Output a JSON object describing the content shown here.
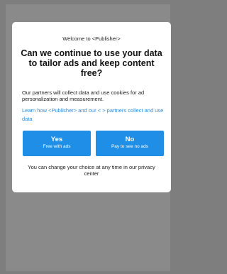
{
  "consent_dialog": {
    "welcome": "Welcome to <Publisher>",
    "headline": "Can we continue to use your data to tailor ads and keep content free?",
    "body": "Our partners will collect data and use cookies for ad personalization and measurement.",
    "learn_link": "Learn how <Publisher> and our <    > partners collect and use data",
    "yes_button": {
      "label": "Yes",
      "sublabel": "Free with ads"
    },
    "no_button": {
      "label": "No",
      "sublabel": "Pay to see no ads"
    },
    "footer_note": "You can change your choice at any time in our privacy center"
  },
  "colors": {
    "backdrop": "#7e7e7e",
    "button": "#1f8ee6",
    "link": "#2b8de0"
  }
}
